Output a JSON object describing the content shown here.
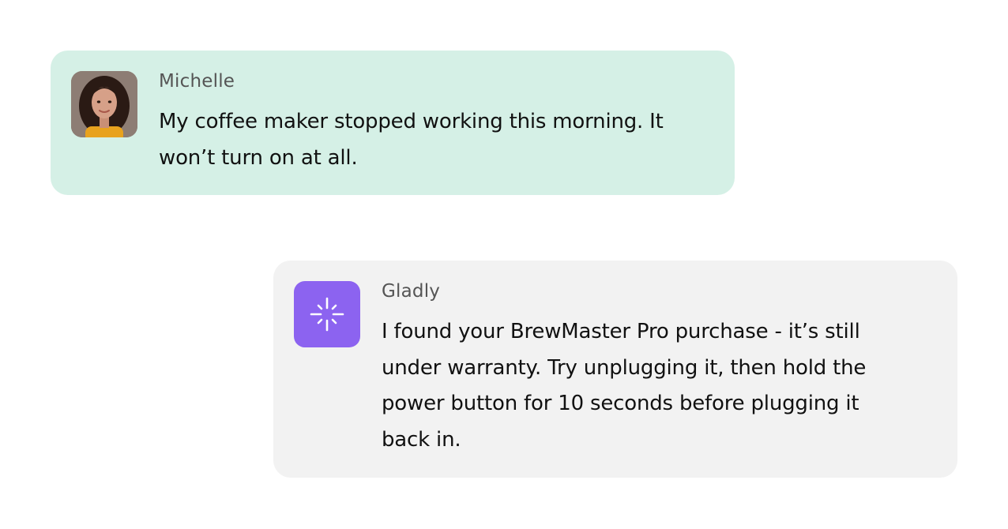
{
  "conversation": {
    "messages": [
      {
        "sender": "Michelle",
        "avatar": "user-photo-avatar",
        "text": "My coffee maker stopped working this morning. It\nwon’t turn on at all.",
        "background": "#d5f0e6"
      },
      {
        "sender": "Gladly",
        "avatar": "gladly-logo-icon",
        "text": "I found your BrewMaster Pro purchase - it’s still\nunder warranty. Try unplugging it, then hold the\npower button for 10 seconds before plugging it\nback in.",
        "background": "#f2f2f2",
        "accent": "#8c63f0"
      }
    ]
  }
}
